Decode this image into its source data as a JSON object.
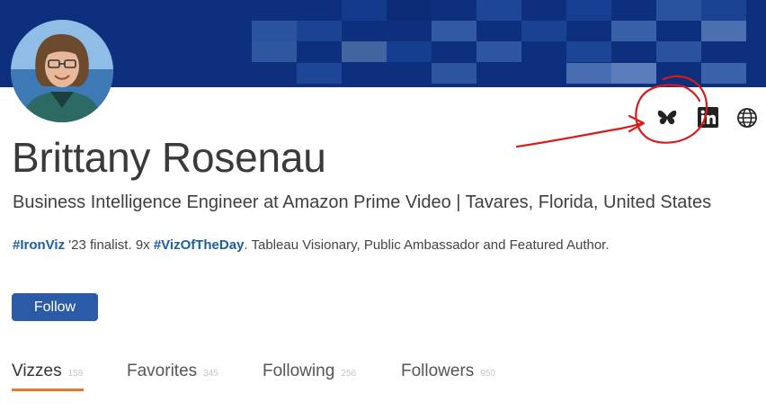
{
  "profile": {
    "name": "Brittany Rosenau",
    "headline": "Business Intelligence Engineer at Amazon Prime Video | Tavares, Florida, United States",
    "bio": {
      "tag1": "#IronViz",
      "text1": " '23 finalist. 9x ",
      "tag2": "#VizOfTheDay",
      "text2": ". Tableau Visionary, Public Ambassador and Featured Author."
    },
    "avatar_icon": "profile-photo"
  },
  "social": [
    {
      "name": "bluesky",
      "icon": "butterfly-icon"
    },
    {
      "name": "linkedin",
      "icon": "linkedin-icon"
    },
    {
      "name": "website",
      "icon": "globe-icon"
    }
  ],
  "actions": {
    "follow_label": "Follow"
  },
  "tabs": [
    {
      "label": "Vizzes",
      "count": "158",
      "active": true
    },
    {
      "label": "Favorites",
      "count": "345",
      "active": false
    },
    {
      "label": "Following",
      "count": "256",
      "active": false
    },
    {
      "label": "Followers",
      "count": "950",
      "active": false
    }
  ],
  "colors": {
    "banner": "#0e2f7e",
    "follow_button": "#2b5aa6",
    "hashtag": "#1c5fa0",
    "tab_underline": "#e8762d",
    "annotation": "#d91a1a"
  }
}
